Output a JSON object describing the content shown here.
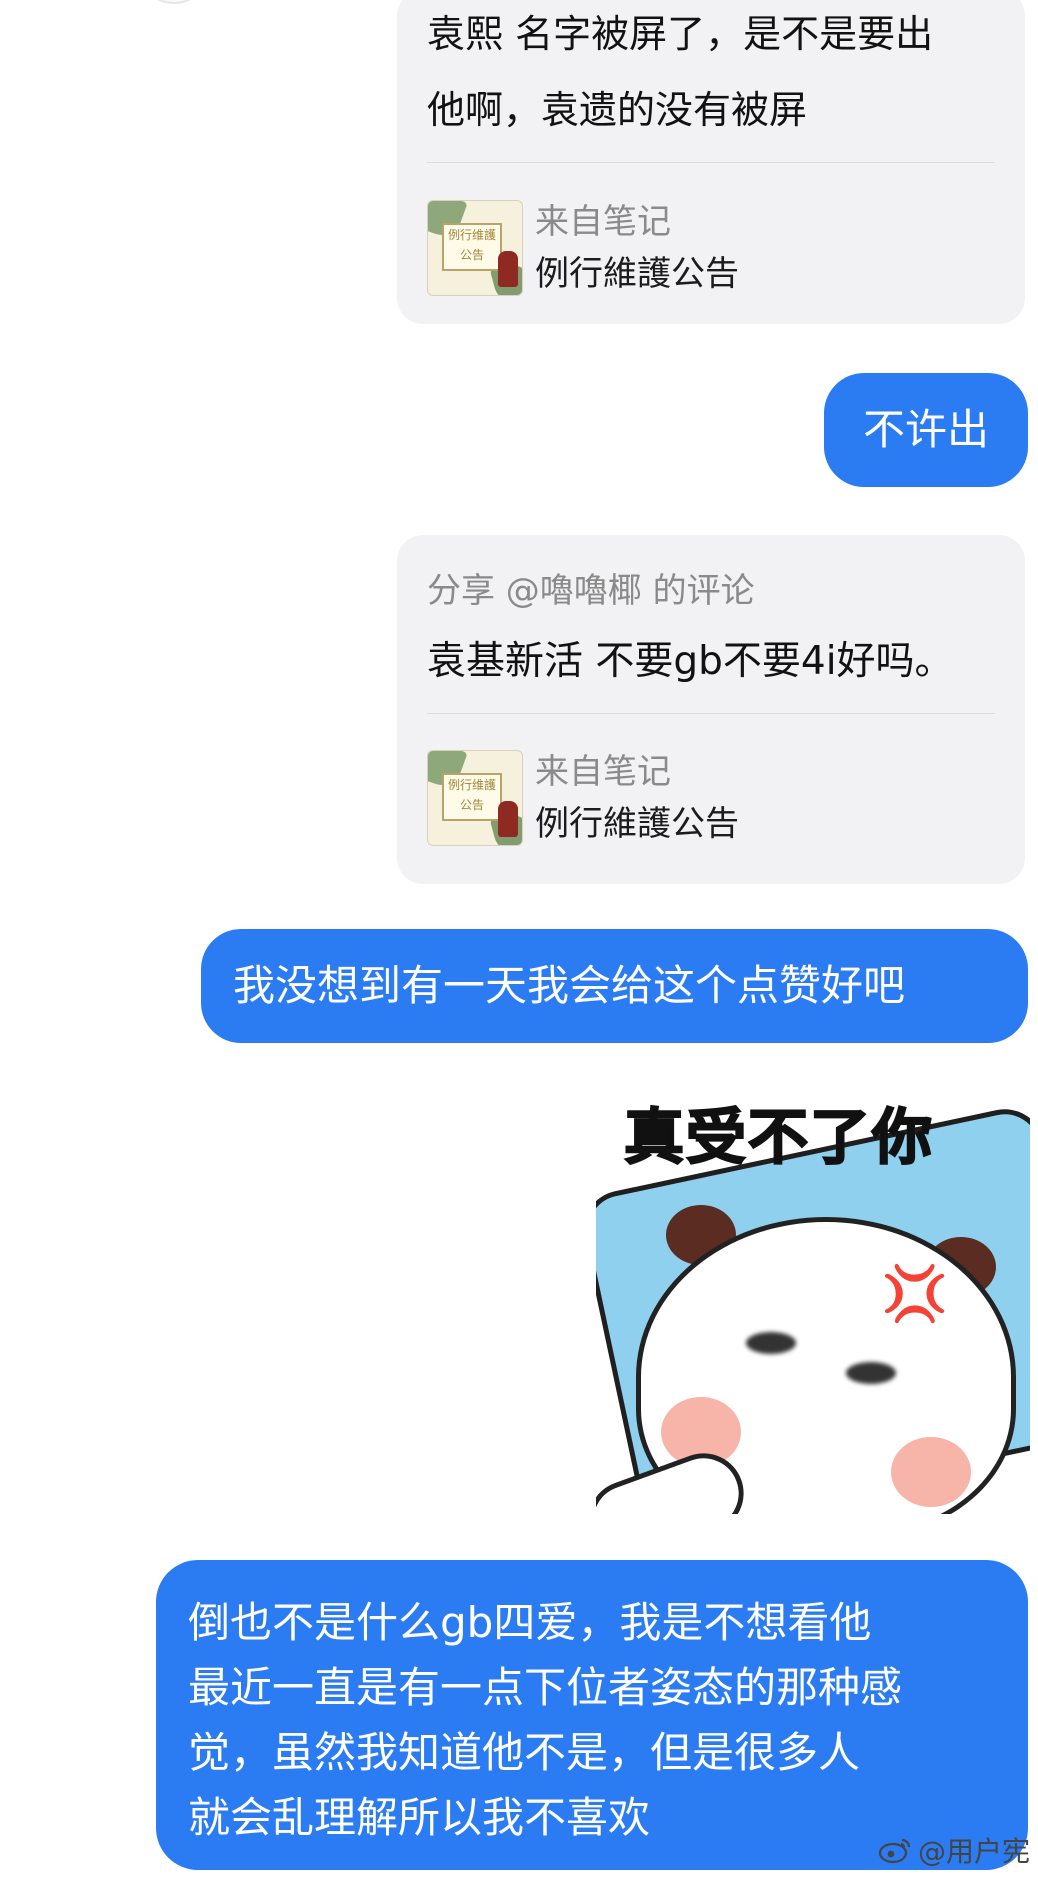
{
  "card1": {
    "text_lines": [
      "袁熙 名字被屏了，是不是要出",
      "他啊，袁遗的没有被屏"
    ],
    "note_label": "来自笔记",
    "note_title": "例行維護公告",
    "thumb_text": [
      "例行维護",
      "公告"
    ]
  },
  "bubble1": {
    "text": "不许出"
  },
  "card2": {
    "share_line": "分享 @嚕嚕椰 的评论",
    "comment": "袁基新活 不要gb不要4i好吗。",
    "note_label": "来自笔记",
    "note_title": "例行維護公告",
    "thumb_text": [
      "例行维護",
      "公告"
    ]
  },
  "bubble2": {
    "text": "我没想到有一天我会给这个点赞好吧"
  },
  "sticker": {
    "caption": "真受不了你",
    "anger_symbol": "💢"
  },
  "bubble3": {
    "lines": [
      "倒也不是什么gb四爱，我是不想看他",
      "最近一直是有一点下位者姿态的那种感",
      "觉，虽然我知道他不是，但是很多人",
      "就会乱理解所以我不喜欢"
    ]
  },
  "watermark": {
    "text": "@用户宪",
    "icon": "weibo-icon"
  },
  "colors": {
    "bubble_blue": "#2b7cf3",
    "card_gray": "#f2f2f4"
  }
}
